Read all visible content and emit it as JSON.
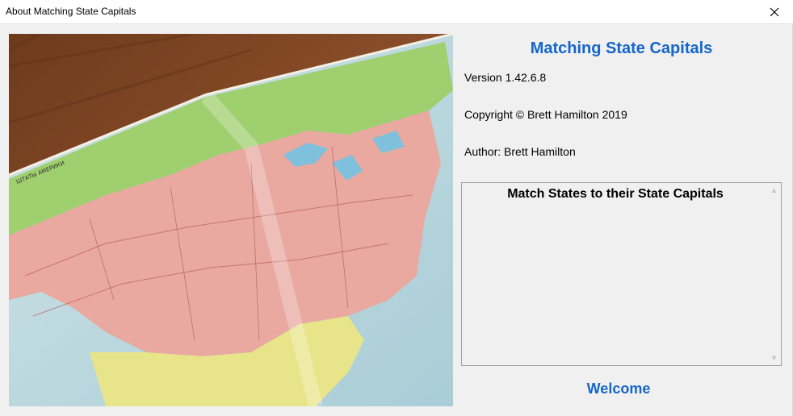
{
  "window": {
    "title": "About Matching State Capitals",
    "close_icon": "close-icon"
  },
  "hero_image": {
    "icon": "us-map-image"
  },
  "about": {
    "app_title": "Matching State Capitals",
    "version": "Version 1.42.6.8",
    "copyright": "Copyright © Brett Hamilton 2019",
    "author": "Author: Brett Hamilton",
    "description": "Match States to their State Capitals",
    "welcome": "Welcome"
  },
  "colors": {
    "accent": "#1466c9",
    "background": "#f0f0f0"
  }
}
